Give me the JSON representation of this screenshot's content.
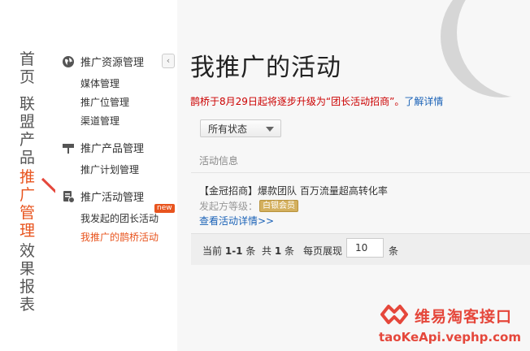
{
  "vnav": [
    {
      "label": "首页",
      "active": false
    },
    {
      "label": "联盟产品",
      "active": false
    },
    {
      "label": "推广管理",
      "active": true
    },
    {
      "label": "效果报表",
      "active": false
    }
  ],
  "sidebar": {
    "collapse_glyph": "‹",
    "groups": [
      {
        "title": "推广资源管理",
        "icon": "globe-icon",
        "items": [
          "媒体管理",
          "推广位管理",
          "渠道管理"
        ]
      },
      {
        "title": "推广产品管理",
        "icon": "flag-icon",
        "items": [
          "推广计划管理"
        ]
      },
      {
        "title": "推广活动管理",
        "icon": "activity-icon",
        "items": [
          "我发起的团长活动",
          "我推广的鹊桥活动"
        ]
      }
    ],
    "new_badge": "new"
  },
  "main": {
    "title": "我推广的活动",
    "notice_text": "鹊桥于8月29日起将逐步升级为“团长活动招商”。",
    "notice_link": "了解详情",
    "filter_value": "所有状态",
    "column_header": "活动信息",
    "row": {
      "title": "【金冠招商】爆款团队 百万流量超高转化率",
      "level_label": "发起方等级：",
      "level_badge": "白银会员",
      "detail_link": "查看活动详情>>"
    },
    "pager": {
      "current_prefix": "当前",
      "current_range": "1-1",
      "current_suffix": "条",
      "total_prefix": "共",
      "total_count": "1",
      "total_suffix": "条",
      "per_page_label": "每页展现",
      "per_page_value": "10",
      "per_page_suffix": "条"
    }
  },
  "watermark": {
    "name": "维易淘客接口",
    "url": "taoKeApi.vephp.com"
  },
  "colors": {
    "accent": "#e8541e",
    "link": "#1a62b7",
    "notice": "#cc0000",
    "watermark": "#e5473b"
  }
}
